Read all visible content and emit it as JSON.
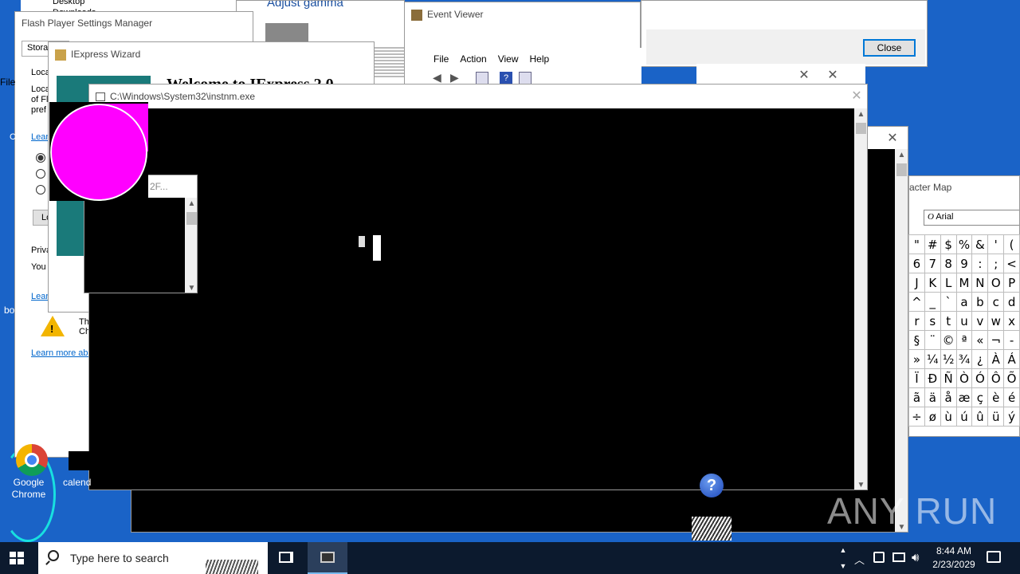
{
  "desktop": {
    "icons": [
      {
        "label": "Google Chrome"
      },
      {
        "label": "calend"
      }
    ],
    "partial_labels": [
      "bo",
      "File",
      "C"
    ],
    "watermark": "ANY RUN"
  },
  "explorer_window": {
    "items": [
      "Desktop",
      "Downloads"
    ]
  },
  "flash_player": {
    "title": "Flash Player Settings Manager",
    "tab": "Stora",
    "lines": [
      "Loca",
      "Loca",
      "of Fl",
      "pref"
    ],
    "learn_link": "Learn",
    "button": "Lo",
    "privacy_heading": "Priva",
    "privacy_text": "You",
    "learn_link2": "Learn",
    "warning_text": [
      "Th",
      "Ch"
    ],
    "learn_more": "Learn more abo"
  },
  "adjust_gamma": {
    "title": "Adjust gamma"
  },
  "iexpress": {
    "title": "IExpress Wizard",
    "heading": "Welcome to IExpress 2.0"
  },
  "event_viewer": {
    "title": "Event Viewer",
    "menu": [
      "File",
      "Action",
      "View",
      "Help"
    ]
  },
  "dialog_top": {
    "close_label": "Close"
  },
  "instnm": {
    "title": "C:\\Windows\\System32\\instnm.exe"
  },
  "small_window": {
    "title": "2F..."
  },
  "char_map": {
    "title": "acter Map",
    "font": "Arial",
    "rows": [
      [
        "\"",
        "#",
        "$",
        "%",
        "&",
        "'",
        "("
      ],
      [
        "6",
        "7",
        "8",
        "9",
        ":",
        ";",
        "<"
      ],
      [
        "J",
        "K",
        "L",
        "M",
        "N",
        "O",
        "P"
      ],
      [
        "^",
        "_",
        "`",
        "a",
        "b",
        "c",
        "d"
      ],
      [
        "r",
        "s",
        "t",
        "u",
        "v",
        "w",
        "x"
      ],
      [
        "§",
        "¨",
        "©",
        "ª",
        "«",
        "¬",
        "-"
      ],
      [
        "»",
        "¼",
        "½",
        "¾",
        "¿",
        "À",
        "Á"
      ],
      [
        "Ï",
        "Ð",
        "Ñ",
        "Ò",
        "Ó",
        "Ô",
        "Õ"
      ],
      [
        "ã",
        "ä",
        "å",
        "æ",
        "ç",
        "è",
        "é"
      ],
      [
        "÷",
        "ø",
        "ù",
        "ú",
        "û",
        "ü",
        "ý"
      ]
    ]
  },
  "taskbar": {
    "search_placeholder": "Type here to search",
    "time": "8:44 AM",
    "date": "2/23/2029"
  },
  "colors": {
    "desktop": "#1a63c7",
    "taskbar": "#0c1a2e",
    "magenta": "#ff00ff",
    "teal": "#1a7a7a"
  }
}
